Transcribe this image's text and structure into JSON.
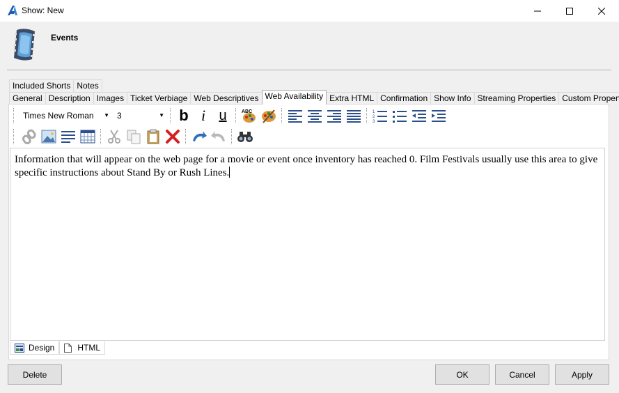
{
  "window": {
    "title": "Show: New"
  },
  "header": {
    "title": "Events"
  },
  "tabs_row1": [
    "Included Shorts",
    "Notes"
  ],
  "tabs_row2": [
    "General",
    "Description",
    "Images",
    "Ticket Verbiage",
    "Web Descriptives",
    "Web Availability",
    "Extra HTML",
    "Confirmation",
    "Show Info",
    "Streaming Properties",
    "Custom Properties"
  ],
  "active_tab": "Web Availability",
  "toolbar": {
    "font_name": "Times New Roman",
    "font_size": "3"
  },
  "editor": {
    "content": "Information that will appear on the web page for a movie or event once inventory has reached 0. Film Festivals usually use this area to give specific instructions about Stand By or Rush Lines."
  },
  "view_tabs": [
    "Design",
    "HTML"
  ],
  "buttons": {
    "delete": "Delete",
    "ok": "OK",
    "cancel": "Cancel",
    "apply": "Apply"
  }
}
